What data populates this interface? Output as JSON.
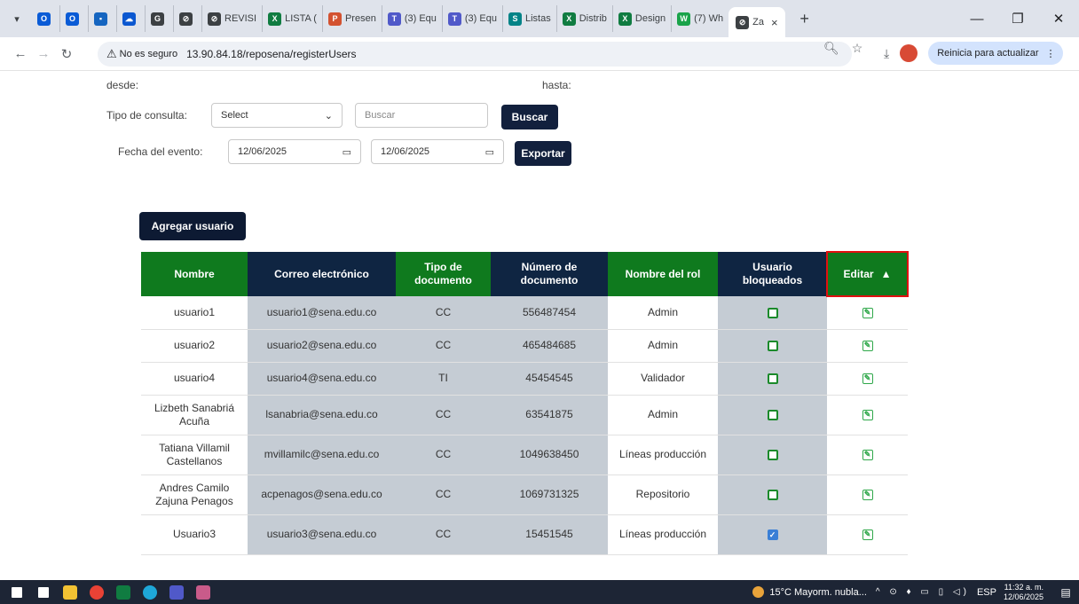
{
  "browser": {
    "tabs": [
      {
        "label": "",
        "color": "#0a5bd6",
        "glyph": "O"
      },
      {
        "label": "",
        "color": "#0a5bd6",
        "glyph": "O"
      },
      {
        "label": "",
        "color": "#1565c0",
        "glyph": "▪"
      },
      {
        "label": "",
        "color": "#0b57d0",
        "glyph": "☁"
      },
      {
        "label": "",
        "color": "#3c4043",
        "glyph": "G"
      },
      {
        "label": "",
        "color": "#3c4043",
        "glyph": "⊘"
      },
      {
        "label": "REVISI",
        "color": "#3c4043",
        "glyph": "⊘"
      },
      {
        "label": "LISTA (",
        "color": "#107c41",
        "glyph": "X"
      },
      {
        "label": "Presen",
        "color": "#d35230",
        "glyph": "P"
      },
      {
        "label": "(3) Equ",
        "color": "#5059c9",
        "glyph": "T"
      },
      {
        "label": "(3) Equ",
        "color": "#5059c9",
        "glyph": "T"
      },
      {
        "label": "Listas",
        "color": "#038387",
        "glyph": "S"
      },
      {
        "label": "Distrib",
        "color": "#107c41",
        "glyph": "X"
      },
      {
        "label": "Design",
        "color": "#107c41",
        "glyph": "X"
      },
      {
        "label": "(7) Wh",
        "color": "#1aa34a",
        "glyph": "W"
      }
    ],
    "active_tab": {
      "label": "Za",
      "close": "×"
    },
    "new_tab": "+",
    "window_controls": {
      "minimize": "—",
      "restore": "❐",
      "close": "✕"
    },
    "security_label": "No es seguro",
    "url": "13.90.84.18/reposena/registerUsers",
    "update_label": "Reinicia para actualizar"
  },
  "filters": {
    "desde_label": "desde:",
    "hasta_label": "hasta:",
    "tipo_consulta_label": "Tipo de consulta:",
    "select_value": "Select",
    "search_placeholder": "Buscar",
    "search_button": "Buscar",
    "fecha_label": "Fecha del evento:",
    "date_from": "12/06/2025",
    "date_to": "12/06/2025",
    "export_button": "Exportar"
  },
  "add_user_button": "Agregar usuario",
  "table": {
    "headers": {
      "nombre": "Nombre",
      "correo": "Correo electrónico",
      "tipo": "Tipo de documento",
      "numero": "Número de documento",
      "rol": "Nombre del rol",
      "bloqueado": "Usuario bloqueados",
      "editar": "Editar"
    },
    "rows": [
      {
        "nombre": "usuario1",
        "correo": "usuario1@sena.edu.co",
        "tipo": "CC",
        "numero": "556487454",
        "rol": "Admin",
        "bloqueado": false
      },
      {
        "nombre": "usuario2",
        "correo": "usuario2@sena.edu.co",
        "tipo": "CC",
        "numero": "465484685",
        "rol": "Admin",
        "bloqueado": false
      },
      {
        "nombre": "usuario4",
        "correo": "usuario4@sena.edu.co",
        "tipo": "TI",
        "numero": "45454545",
        "rol": "Validador",
        "bloqueado": false
      },
      {
        "nombre": "Lizbeth Sanabriá Acuña",
        "correo": "lsanabria@sena.edu.co",
        "tipo": "CC",
        "numero": "63541875",
        "rol": "Admin",
        "bloqueado": false
      },
      {
        "nombre": "Tatiana Villamil Castellanos",
        "correo": "mvillamilc@sena.edu.co",
        "tipo": "CC",
        "numero": "1049638450",
        "rol": "Líneas producción",
        "bloqueado": false
      },
      {
        "nombre": "Andres Camilo Zajuna Penagos",
        "correo": "acpenagos@sena.edu.co",
        "tipo": "CC",
        "numero": "1069731325",
        "rol": "Repositorio",
        "bloqueado": false
      },
      {
        "nombre": "Usuario3",
        "correo": "usuario3@sena.edu.co",
        "tipo": "CC",
        "numero": "15451545",
        "rol": "Líneas producción",
        "bloqueado": true
      }
    ]
  },
  "taskbar": {
    "apps": [
      {
        "name": "start",
        "color": "#ffffff"
      },
      {
        "name": "task-view",
        "color": "#ffffff"
      },
      {
        "name": "file-explorer",
        "color": "#f2c233"
      },
      {
        "name": "chrome",
        "color": "#e94235"
      },
      {
        "name": "excel",
        "color": "#107c41"
      },
      {
        "name": "edge",
        "color": "#1ea7d8"
      },
      {
        "name": "teams",
        "color": "#5059c9"
      },
      {
        "name": "snipping",
        "color": "#c95b8a"
      }
    ],
    "weather": "15°C  Mayorm. nubla...",
    "tray_icons": "^ ⊙ ♦ ▭ ▯ ◁)",
    "language": "ESP",
    "time": "11:32 a. m.",
    "date": "12/06/2025"
  }
}
